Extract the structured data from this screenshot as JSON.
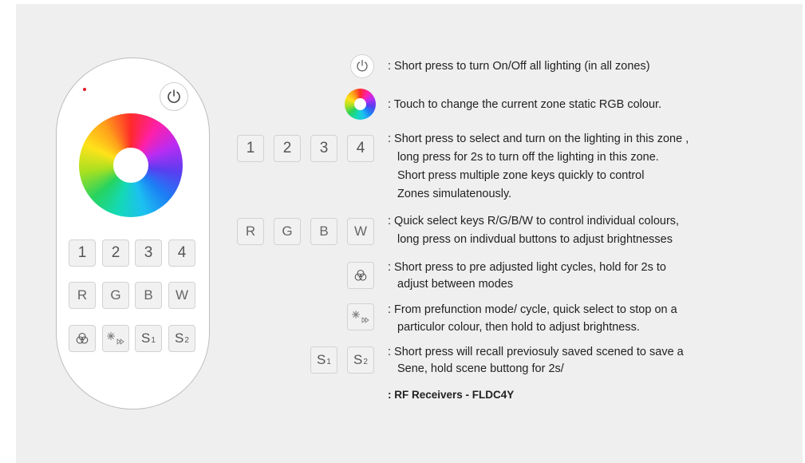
{
  "remote": {
    "zone_keys": [
      "1",
      "2",
      "3",
      "4"
    ],
    "color_keys": [
      "R",
      "G",
      "B",
      "W"
    ],
    "scene_keys": [
      {
        "main": "S",
        "sub": "1"
      },
      {
        "main": "S",
        "sub": "2"
      }
    ]
  },
  "legend": {
    "power": ": Short press to turn On/Off all lighting (in all zones)",
    "wheel": ": Touch to change the current zone static RGB colour.",
    "zones": [
      ": Short press to select and turn on the lighting in this zone ,",
      "long press for 2s to turn off  the lighting in this  zone.",
      "Short press multiple zone keys  quickly to control",
      "Zones simulatenously."
    ],
    "colors": [
      ": Quick select keys R/G/B/W to control individual colours,",
      "long press on indivdual buttons to adjust brightnesses"
    ],
    "cycles": [
      ": Short press to pre adjusted light cycles, hold for 2s to",
      "adjust between modes"
    ],
    "prefunction": [
      ": From prefunction mode/ cycle, quick select to stop on a",
      "particulor colour, then hold to adjust brightness."
    ],
    "scenes": [
      ": Short press will recall previosuly saved scened to save a",
      "Sene, hold scene buttong for 2s/"
    ],
    "receivers": ": RF Receivers - FLDC4Y"
  },
  "colors": {
    "background": "#efefef",
    "led": "#e01c2a",
    "key_fill": "#f1f1f1"
  },
  "icons": [
    "power-icon",
    "color-wheel-icon",
    "cycle-icon",
    "sparkle-play-icon"
  ]
}
